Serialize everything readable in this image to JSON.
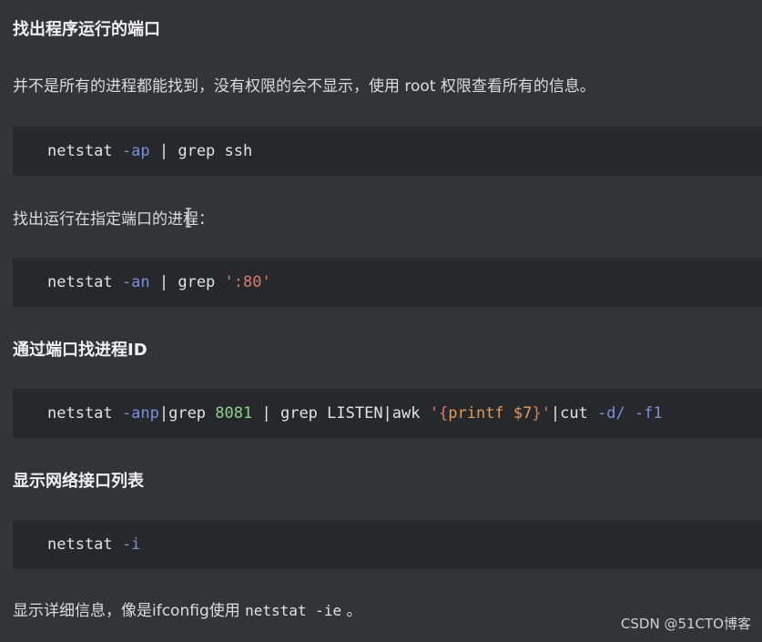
{
  "sections": [
    {
      "heading": "找出程序运行的端口"
    },
    {
      "para": "并不是所有的进程都能找到，没有权限的会不显示，使用 root 权限查看所有的信息。"
    },
    {
      "code": {
        "cmd": "netstat",
        "opt": "-ap",
        "rest": "| grep ssh"
      }
    },
    {
      "para": "找出运行在指定端口的进程："
    },
    {
      "code": {
        "cmd": "netstat",
        "opt": "-an",
        "rest": "| grep",
        "str": "':80'"
      }
    },
    {
      "heading": "通过端口找进程ID"
    },
    {
      "code": {
        "cmd": "netstat",
        "opt": "-anp",
        "p1": "|grep",
        "num": "8081",
        "p2": "| grep LISTEN|awk",
        "awk_open": "'{",
        "awk_cmd": "printf $7",
        "awk_close": "}'",
        "p3": "|cut",
        "opt2": "-d/",
        "opt3": "-f1"
      }
    },
    {
      "heading": "显示网络接口列表"
    },
    {
      "code": {
        "cmd": "netstat",
        "opt": "-i"
      }
    },
    {
      "para_prefix": "显示详细信息，像是ifconfig使用",
      "inline_code": "netstat -ie",
      "para_suffix": "。"
    }
  ],
  "watermark": "CSDN @51CTO博客"
}
